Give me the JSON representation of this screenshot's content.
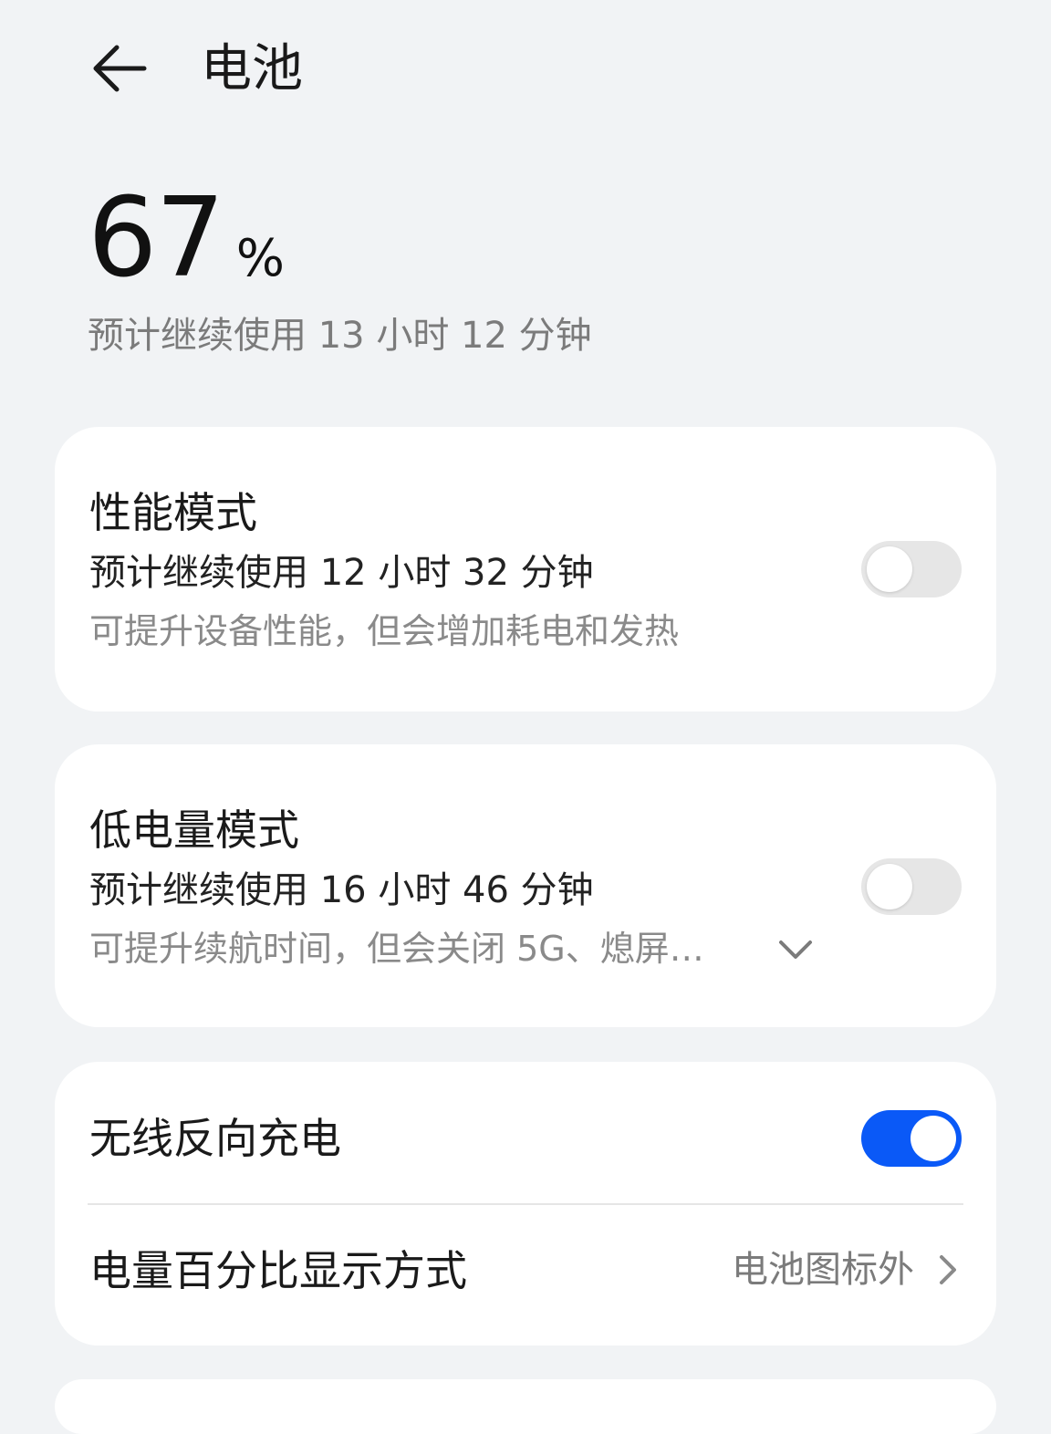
{
  "header": {
    "title": "电池",
    "back_icon": "arrow-left-icon"
  },
  "battery": {
    "level": "67",
    "unit": "%",
    "estimate": "预计继续使用 13 小时 12 分钟"
  },
  "performance_mode": {
    "title": "性能模式",
    "estimate": "预计继续使用 12 小时 32 分钟",
    "description": "可提升设备性能，但会增加耗电和发热",
    "enabled": false
  },
  "low_power_mode": {
    "title": "低电量模式",
    "estimate": "预计继续使用 16 小时 46 分钟",
    "description": "可提升续航时间，但会关闭 5G、熄屏…",
    "enabled": false,
    "expand_icon": "chevron-down-icon"
  },
  "wireless_reverse_charging": {
    "title": "无线反向充电",
    "enabled": true
  },
  "battery_percentage_display": {
    "title": "电量百分比显示方式",
    "value": "电池图标外",
    "icon": "chevron-right-icon"
  },
  "colors": {
    "background": "#f1f3f5",
    "card": "#ffffff",
    "accent": "#0a59f7",
    "toggle_off": "#e6e6e6"
  }
}
